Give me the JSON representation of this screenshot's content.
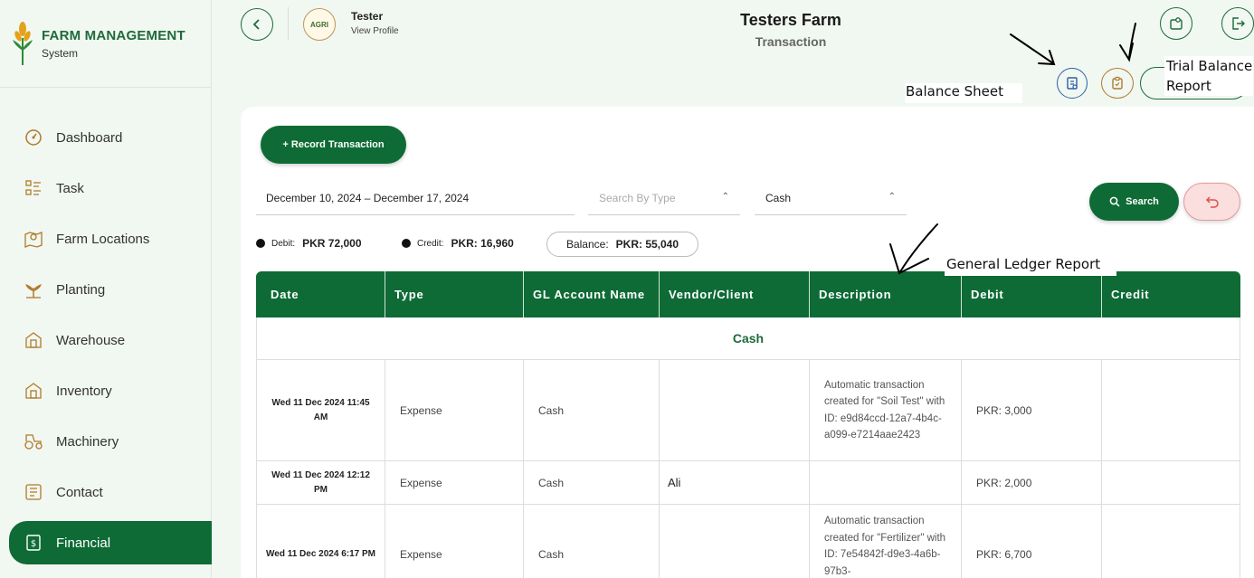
{
  "brand": {
    "title": "FARM MANAGEMENT",
    "subtitle": "System"
  },
  "sidebar": {
    "items": [
      {
        "label": "Dashboard",
        "icon": "dashboard-icon"
      },
      {
        "label": "Task",
        "icon": "task-list-icon"
      },
      {
        "label": "Farm Locations",
        "icon": "map-pin-icon"
      },
      {
        "label": "Planting",
        "icon": "sprout-icon"
      },
      {
        "label": "Warehouse",
        "icon": "warehouse-icon"
      },
      {
        "label": "Inventory",
        "icon": "inventory-icon"
      },
      {
        "label": "Machinery",
        "icon": "tractor-icon"
      },
      {
        "label": "Contact",
        "icon": "contact-card-icon"
      },
      {
        "label": "Financial",
        "icon": "financial-receipt-icon",
        "active": true
      }
    ]
  },
  "header": {
    "user_name": "Tester",
    "user_link": "View Profile",
    "avatar_text": "AGRI",
    "title": "Testers Farm",
    "subtitle": "Transaction"
  },
  "annotations": {
    "balance_sheet": "Balance Sheet",
    "trial_balance": "Trial Balance Report",
    "general_ledger": "General Ledger Report"
  },
  "toolbar": {
    "record_label": "+ Record Transaction",
    "date_range": "December 10, 2024 – December 17, 2024",
    "type_placeholder": "Search By Type",
    "account_value": "Cash",
    "search_label": "Search"
  },
  "summary": {
    "debit_label": "Debit:",
    "debit_value": "PKR 72,000",
    "credit_label": "Credit:",
    "credit_value": "PKR: 16,960",
    "balance_label": "Balance:",
    "balance_value": "PKR: 55,040"
  },
  "table": {
    "columns": [
      "Date",
      "Type",
      "GL Account Name",
      "Vendor/Client",
      "Description",
      "Debit",
      "Credit"
    ],
    "group": "Cash",
    "rows": [
      {
        "date": "Wed 11 Dec 2024 11:45 AM",
        "type": "Expense",
        "account": "Cash",
        "vendor": "",
        "description": "Automatic transaction created for \"Soil Test\" with ID: e9d84ccd-12a7-4b4c-a099-e7214aae2423",
        "debit": "PKR: 3,000",
        "credit": ""
      },
      {
        "date": "Wed 11 Dec 2024 12:12 PM",
        "type": "Expense",
        "account": "Cash",
        "vendor": "Ali",
        "description": "",
        "debit": "PKR: 2,000",
        "credit": ""
      },
      {
        "date": "Wed 11 Dec 2024 6:17 PM",
        "type": "Expense",
        "account": "Cash",
        "vendor": "",
        "description": "Automatic transaction created for \"Fertilizer\" with ID: 7e54842f-d9e3-4a6b-97b3-",
        "debit": "PKR: 6,700",
        "credit": ""
      }
    ]
  },
  "colors": {
    "primary": "#0e6b35",
    "background": "#f1f7f1",
    "reset": "#fbdede"
  }
}
